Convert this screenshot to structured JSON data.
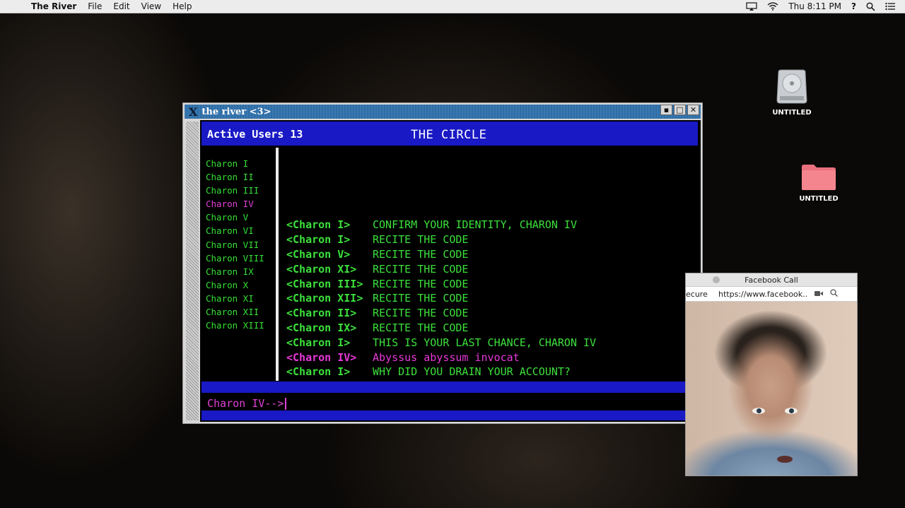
{
  "menubar": {
    "apple_glyph": "",
    "app_name": "The River",
    "items": [
      "File",
      "Edit",
      "View",
      "Help"
    ],
    "clock": "Thu 8:11 PM",
    "help": "?"
  },
  "desktop": {
    "icons": [
      {
        "label": "UNTITLED",
        "kind": "drive"
      },
      {
        "label": "UNTITLED",
        "kind": "folder"
      }
    ]
  },
  "xwindow": {
    "logo": "X",
    "title": "the river <3>",
    "buttons": [
      "▪",
      "□",
      "✕"
    ],
    "header": {
      "active_users": "Active Users 13",
      "room_title": "THE CIRCLE"
    },
    "users": [
      {
        "name": "Charon I",
        "me": false
      },
      {
        "name": "Charon II",
        "me": false
      },
      {
        "name": "Charon III",
        "me": false
      },
      {
        "name": "Charon IV",
        "me": true
      },
      {
        "name": "Charon V",
        "me": false
      },
      {
        "name": "Charon VI",
        "me": false
      },
      {
        "name": "Charon VII",
        "me": false
      },
      {
        "name": "Charon VIII",
        "me": false
      },
      {
        "name": "Charon IX",
        "me": false
      },
      {
        "name": "Charon X",
        "me": false
      },
      {
        "name": "Charon XI",
        "me": false
      },
      {
        "name": "Charon XII",
        "me": false
      },
      {
        "name": "Charon XIII",
        "me": false
      }
    ],
    "messages": [
      {
        "who": "<Charon I>",
        "text": "CONFIRM YOUR IDENTITY, CHARON IV",
        "me": false
      },
      {
        "who": "<Charon I>",
        "text": "RECITE THE CODE",
        "me": false
      },
      {
        "who": "<Charon V>",
        "text": "RECITE THE CODE",
        "me": false
      },
      {
        "who": "<Charon XI>",
        "text": "RECITE THE CODE",
        "me": false
      },
      {
        "who": "<Charon III>",
        "text": "RECITE THE CODE",
        "me": false
      },
      {
        "who": "<Charon XII>",
        "text": "RECITE THE CODE",
        "me": false
      },
      {
        "who": "<Charon II>",
        "text": "RECITE THE CODE",
        "me": false
      },
      {
        "who": "<Charon IX>",
        "text": "RECITE THE CODE",
        "me": false
      },
      {
        "who": "<Charon I>",
        "text": "THIS IS YOUR LAST CHANCE, CHARON IV",
        "me": false
      },
      {
        "who": "<Charon IV>",
        "text": "Abyssus abyssum invocat",
        "me": true
      },
      {
        "who": "<Charon I>",
        "text": "WHY DID YOU DRAIN YOUR ACCOUNT?",
        "me": false
      }
    ],
    "prompt": "Charon IV-->"
  },
  "facebook_call": {
    "title": "Facebook Call",
    "secure": "ecure",
    "url": "https://www.facebook...."
  },
  "colors": {
    "terminal_green": "#3ce03c",
    "terminal_magenta": "#e040d8",
    "terminal_blue": "#1919c6"
  }
}
